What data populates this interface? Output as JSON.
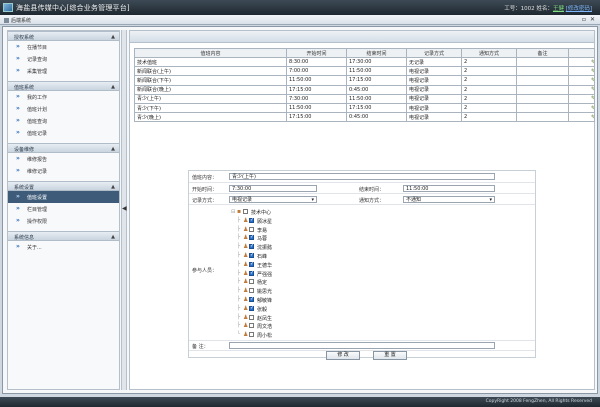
{
  "app": {
    "title": "海盐县传媒中心[综合业务管理平台]",
    "user_label": "工号：1002 姓名：",
    "user_name": "王健",
    "change_password": "[修改密码]",
    "window_caption": "后端系统",
    "copyright": "CopyRight 2008 FengZhen, All Rights Reserved"
  },
  "sidebar": {
    "sections": [
      {
        "title": "授权系统",
        "items": [
          {
            "label": "在播节目"
          },
          {
            "label": "记录查询"
          },
          {
            "label": "采集管理"
          }
        ]
      },
      {
        "title": "值班系统",
        "items": [
          {
            "label": "我的工作"
          },
          {
            "label": "值班计划"
          },
          {
            "label": "值班查询"
          },
          {
            "label": "值班记录"
          }
        ]
      },
      {
        "title": "设备维修",
        "items": [
          {
            "label": "维修报告"
          },
          {
            "label": "维修记录"
          }
        ]
      },
      {
        "title": "系统设置",
        "items": [
          {
            "label": "值班设置",
            "active": true
          },
          {
            "label": "栏目管理"
          },
          {
            "label": "操作权限"
          }
        ]
      },
      {
        "title": "系统信息",
        "items": [
          {
            "label": "关于..."
          }
        ]
      }
    ]
  },
  "table": {
    "headers": [
      "值班内容",
      "开始时间",
      "结束时间",
      "记录方式",
      "通知方式",
      "备注",
      ""
    ],
    "rows": [
      [
        "技术值班",
        "8:30:00",
        "17:30:00",
        "无记录",
        "2",
        ""
      ],
      [
        "新闻联合(上午)",
        "7:00:00",
        "11:50:00",
        "电视记录",
        "2",
        ""
      ],
      [
        "新闻联合(下午)",
        "11:50:00",
        "17:15:00",
        "电视记录",
        "2",
        ""
      ],
      [
        "新闻联合(晚上)",
        "17:15:00",
        "0:45:00",
        "电视记录",
        "2",
        ""
      ],
      [
        "青少(上午)",
        "7:30:00",
        "11:50:00",
        "电视记录",
        "2",
        ""
      ],
      [
        "青少(下午)",
        "11:50:00",
        "17:15:00",
        "电视记录",
        "2",
        ""
      ],
      [
        "青少(晚上)",
        "17:15:00",
        "0:45:00",
        "电视记录",
        "2",
        ""
      ]
    ]
  },
  "form": {
    "content_label": "值班内容：",
    "content_value": "青少(上午)",
    "start_label": "开始时间：",
    "start_value": "7:30:00",
    "end_label": "结束时间：",
    "end_value": "11:50:00",
    "record_label": "记录方式：",
    "record_value": "电视记录",
    "notify_label": "通知方式：",
    "notify_value": "不通知",
    "people_label": "参与人员：",
    "remark_label": "备 注：",
    "remark_value": "",
    "tree_root": "技术中心",
    "people": [
      {
        "name": "顾冰星",
        "checked": true
      },
      {
        "name": "李易",
        "checked": false
      },
      {
        "name": "马蓉",
        "checked": true
      },
      {
        "name": "沈振懿",
        "checked": true
      },
      {
        "name": "石峰",
        "checked": true
      },
      {
        "name": "王德华",
        "checked": true
      },
      {
        "name": "严强强",
        "checked": true
      },
      {
        "name": "杨定",
        "checked": false
      },
      {
        "name": "姚思光",
        "checked": false
      },
      {
        "name": "郁敏锋",
        "checked": true
      },
      {
        "name": "张毅",
        "checked": true
      },
      {
        "name": "赵凤生",
        "checked": false
      },
      {
        "name": "周文浩",
        "checked": false
      },
      {
        "name": "周小松",
        "checked": false
      }
    ],
    "edit_button": "修 改",
    "reset_button": "重 置"
  },
  "colors": {
    "accent": "#3e5c7a",
    "delete": "#d02020",
    "check": "#2d6fc9"
  }
}
